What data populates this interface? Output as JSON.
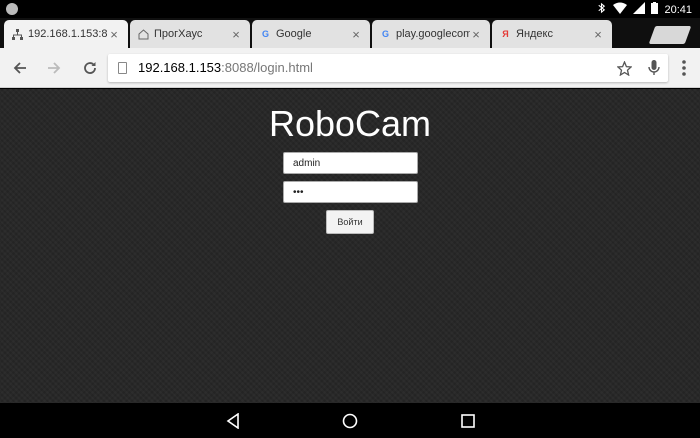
{
  "status_bar": {
    "time": "20:41"
  },
  "tabs": [
    {
      "title": "192.168.1.153:8",
      "favicon": "network-icon",
      "close": "×"
    },
    {
      "title": "ПрогХаус",
      "favicon": "house-icon",
      "close": "×"
    },
    {
      "title": "Google",
      "favicon": "G",
      "close": "×"
    },
    {
      "title": "play.googlecom",
      "favicon": "G",
      "close": "×"
    },
    {
      "title": "Яндекс",
      "favicon": "Я",
      "close": "×"
    }
  ],
  "toolbar": {
    "url_host": "192.168.1.153",
    "url_rest": ":8088/login.html"
  },
  "page": {
    "title": "RoboCam",
    "username_value": "admin",
    "password_value": "•••",
    "login_label": "Войти"
  },
  "colors": {
    "page_bg": "#262626",
    "toolbar_bg": "#f2f2f2",
    "tab_bg": "#e2e2e2"
  }
}
